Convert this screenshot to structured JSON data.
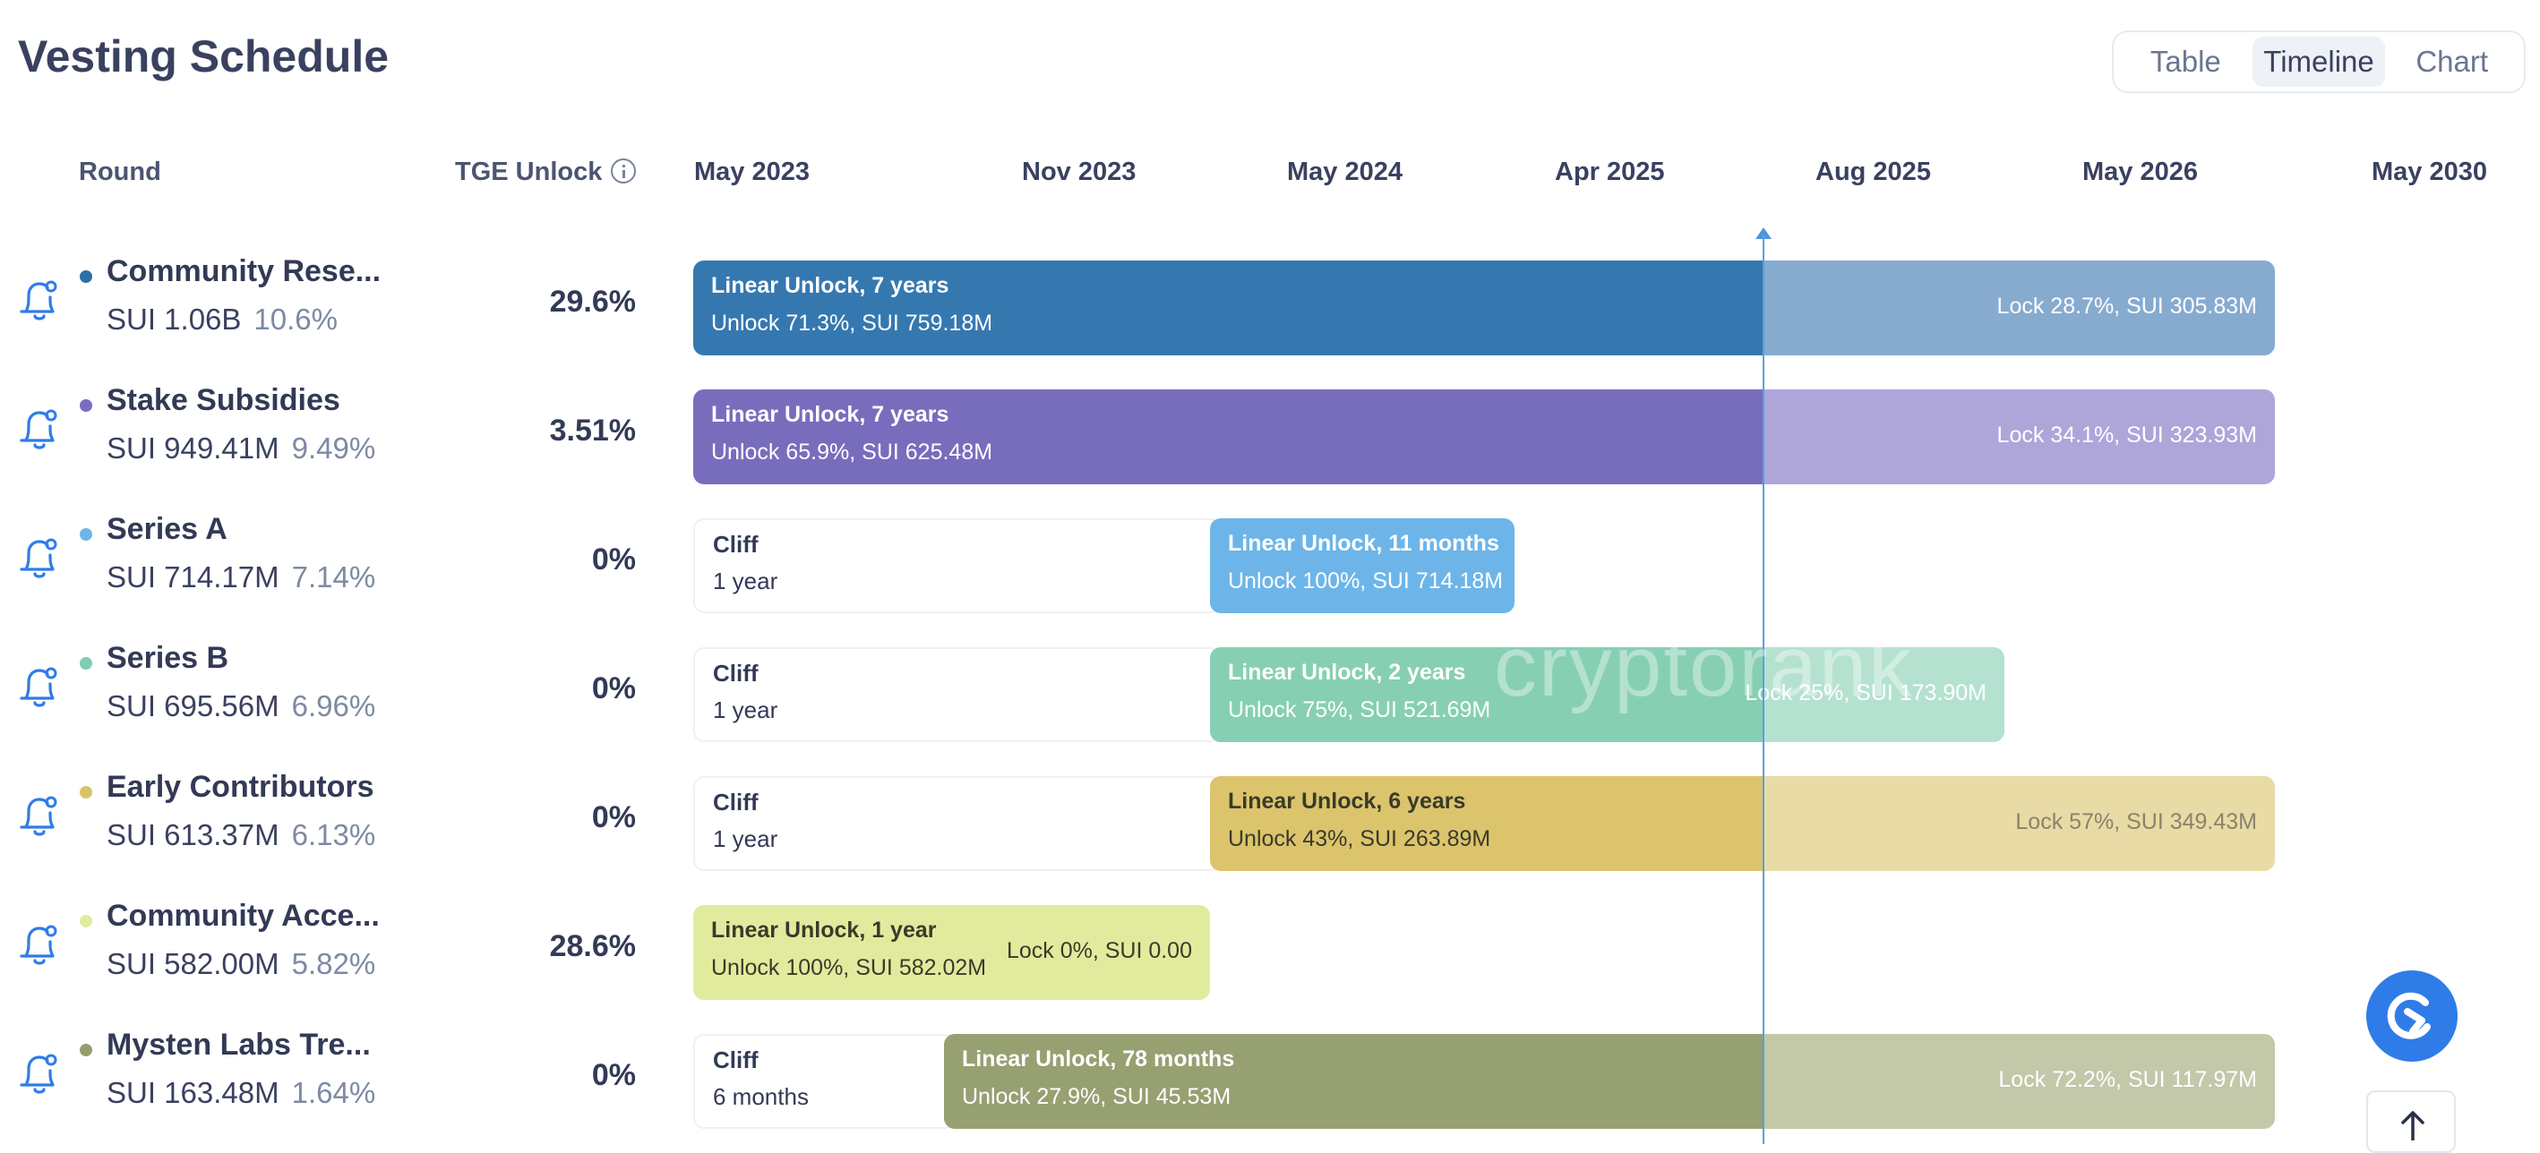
{
  "title": "Vesting Schedule",
  "view_toggle": [
    "Table",
    "Timeline",
    "Chart"
  ],
  "view_active": "Timeline",
  "headers": {
    "round": "Round",
    "tge_unlock": "TGE Unlock"
  },
  "timeline_labels": [
    "May 2023",
    "Nov 2023",
    "May 2024",
    "Apr 2025",
    "Aug 2025",
    "May 2026",
    "May 2030"
  ],
  "watermark": "cryptorank",
  "accent_color": "#2f7ce8",
  "rows": [
    {
      "name": "Community Rese...",
      "amount": "SUI 1.06B",
      "pct": "10.6%",
      "tge": "29.6%",
      "dot_color": "#2f6fa8",
      "cliff": null,
      "bar": {
        "t1": "Linear Unlock, 7 years",
        "t2": "Unlock 71.3%, SUI 759.18M",
        "lock": "Lock 28.7%, SUI 305.83M",
        "color": "#3578b0",
        "rest_color": "#86abcf",
        "text_color": "#ffffff",
        "lock_color": "#ffffff"
      }
    },
    {
      "name": "Stake Subsidies",
      "amount": "SUI 949.41M",
      "pct": "9.49%",
      "tge": "3.51%",
      "dot_color": "#7b6cc4",
      "cliff": null,
      "bar": {
        "t1": "Linear Unlock, 7 years",
        "t2": "Unlock 65.9%, SUI 625.48M",
        "lock": "Lock 34.1%, SUI 323.93M",
        "color": "#786dbd",
        "rest_color": "#aea6d9",
        "text_color": "#ffffff",
        "lock_color": "#ffffff"
      }
    },
    {
      "name": "Series A",
      "amount": "SUI 714.17M",
      "pct": "7.14%",
      "tge": "0%",
      "dot_color": "#6cb5ea",
      "cliff": {
        "t1": "Cliff",
        "t2": "1 year"
      },
      "bar": {
        "t1": "Linear Unlock, 11 months",
        "t2": "Unlock 100%, SUI 714.18M",
        "lock": "",
        "color": "#6db5e8",
        "rest_color": "#6db5e8",
        "text_color": "#ffffff",
        "lock_color": "#ffffff"
      }
    },
    {
      "name": "Series B",
      "amount": "SUI 695.56M",
      "pct": "6.96%",
      "tge": "0%",
      "dot_color": "#7fcdb0",
      "cliff": {
        "t1": "Cliff",
        "t2": "1 year"
      },
      "bar": {
        "t1": "Linear Unlock, 2 years",
        "t2": "Unlock 75%, SUI 521.69M",
        "lock": "Lock 25%, SUI 173.90M",
        "color": "#87cfb3",
        "rest_color": "#b5e2d0",
        "text_color": "#ffffff",
        "lock_color": "#ffffff"
      }
    },
    {
      "name": "Early Contributors",
      "amount": "SUI 613.37M",
      "pct": "6.13%",
      "tge": "0%",
      "dot_color": "#d9c36a",
      "cliff": {
        "t1": "Cliff",
        "t2": "1 year"
      },
      "bar": {
        "t1": "Linear Unlock, 6 years",
        "t2": "Unlock 43%, SUI 263.89M",
        "lock": "Lock 57%, SUI 349.43M",
        "color": "#dbc46c",
        "rest_color": "#e9dba6",
        "text_color": "#3a3a2a",
        "lock_color": "#8a836a"
      }
    },
    {
      "name": "Community Acce...",
      "amount": "SUI 582.00M",
      "pct": "5.82%",
      "tge": "28.6%",
      "dot_color": "#e0ec9e",
      "cliff": null,
      "bar": {
        "t1": "Linear Unlock, 1 year",
        "t2": "Unlock 100%, SUI 582.02M",
        "lock": "Lock 0%, SUI 0.00",
        "color": "#e1eb9d",
        "rest_color": "#e1eb9d",
        "text_color": "#3a3a2a",
        "lock_color": "#3a3a2a"
      }
    },
    {
      "name": "Mysten Labs Tre...",
      "amount": "SUI 163.48M",
      "pct": "1.64%",
      "tge": "0%",
      "dot_color": "#939f6e",
      "cliff": {
        "t1": "Cliff",
        "t2": "6 months"
      },
      "bar": {
        "t1": "Linear Unlock, 78 months",
        "t2": "Unlock 27.9%, SUI 45.53M",
        "lock": "Lock 72.2%, SUI 117.97M",
        "color": "#96a071",
        "rest_color": "#c2c8a8",
        "text_color": "#ffffff",
        "lock_color": "#ffffff"
      }
    }
  ]
}
